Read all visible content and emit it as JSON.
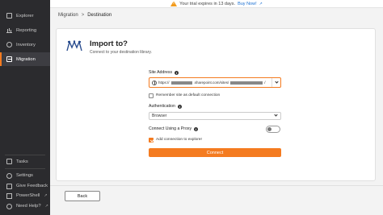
{
  "banner": {
    "text": "Your trial expires in 13 days.",
    "buy_label": "Buy Now!"
  },
  "sidebar": {
    "items": [
      {
        "label": "Explorer",
        "icon": "explorer-icon",
        "active": false
      },
      {
        "label": "Reporting",
        "icon": "reporting-icon",
        "active": false
      },
      {
        "label": "Inventory",
        "icon": "inventory-icon",
        "active": false
      },
      {
        "label": "Migration",
        "icon": "migration-icon",
        "active": true
      }
    ],
    "bottom": [
      {
        "label": "Tasks",
        "icon": "tasks-icon"
      },
      {
        "label": "Settings",
        "icon": "settings-icon"
      },
      {
        "label": "Give Feedback",
        "icon": "feedback-icon"
      },
      {
        "label": "PowerShell",
        "icon": "powershell-icon",
        "external": true
      },
      {
        "label": "Need Help?",
        "icon": "help-icon",
        "external": true
      }
    ]
  },
  "breadcrumb": {
    "parent": "Migration",
    "separator": ">",
    "current": "Destination"
  },
  "main": {
    "title": "Import to?",
    "subtitle": "Connect to your destination library.",
    "site_address": {
      "label": "Site Address",
      "value_prefix": "https://",
      "value_domain": ".sharepoint.com/sites/",
      "value_suffix": "/"
    },
    "remember": {
      "label": "Remember site as default connection",
      "checked": false
    },
    "authentication": {
      "label": "Authentication",
      "value": "Browser"
    },
    "proxy": {
      "label": "Connect Using a Proxy",
      "enabled": false
    },
    "add_to_explorer": {
      "label": "Add connection to explorer",
      "checked": true
    },
    "connect_label": "Connect"
  },
  "footer": {
    "back_label": "Back"
  },
  "colors": {
    "accent": "#f47b20",
    "sidebar_bg": "#2b2b2e",
    "link": "#1a6fd1"
  }
}
